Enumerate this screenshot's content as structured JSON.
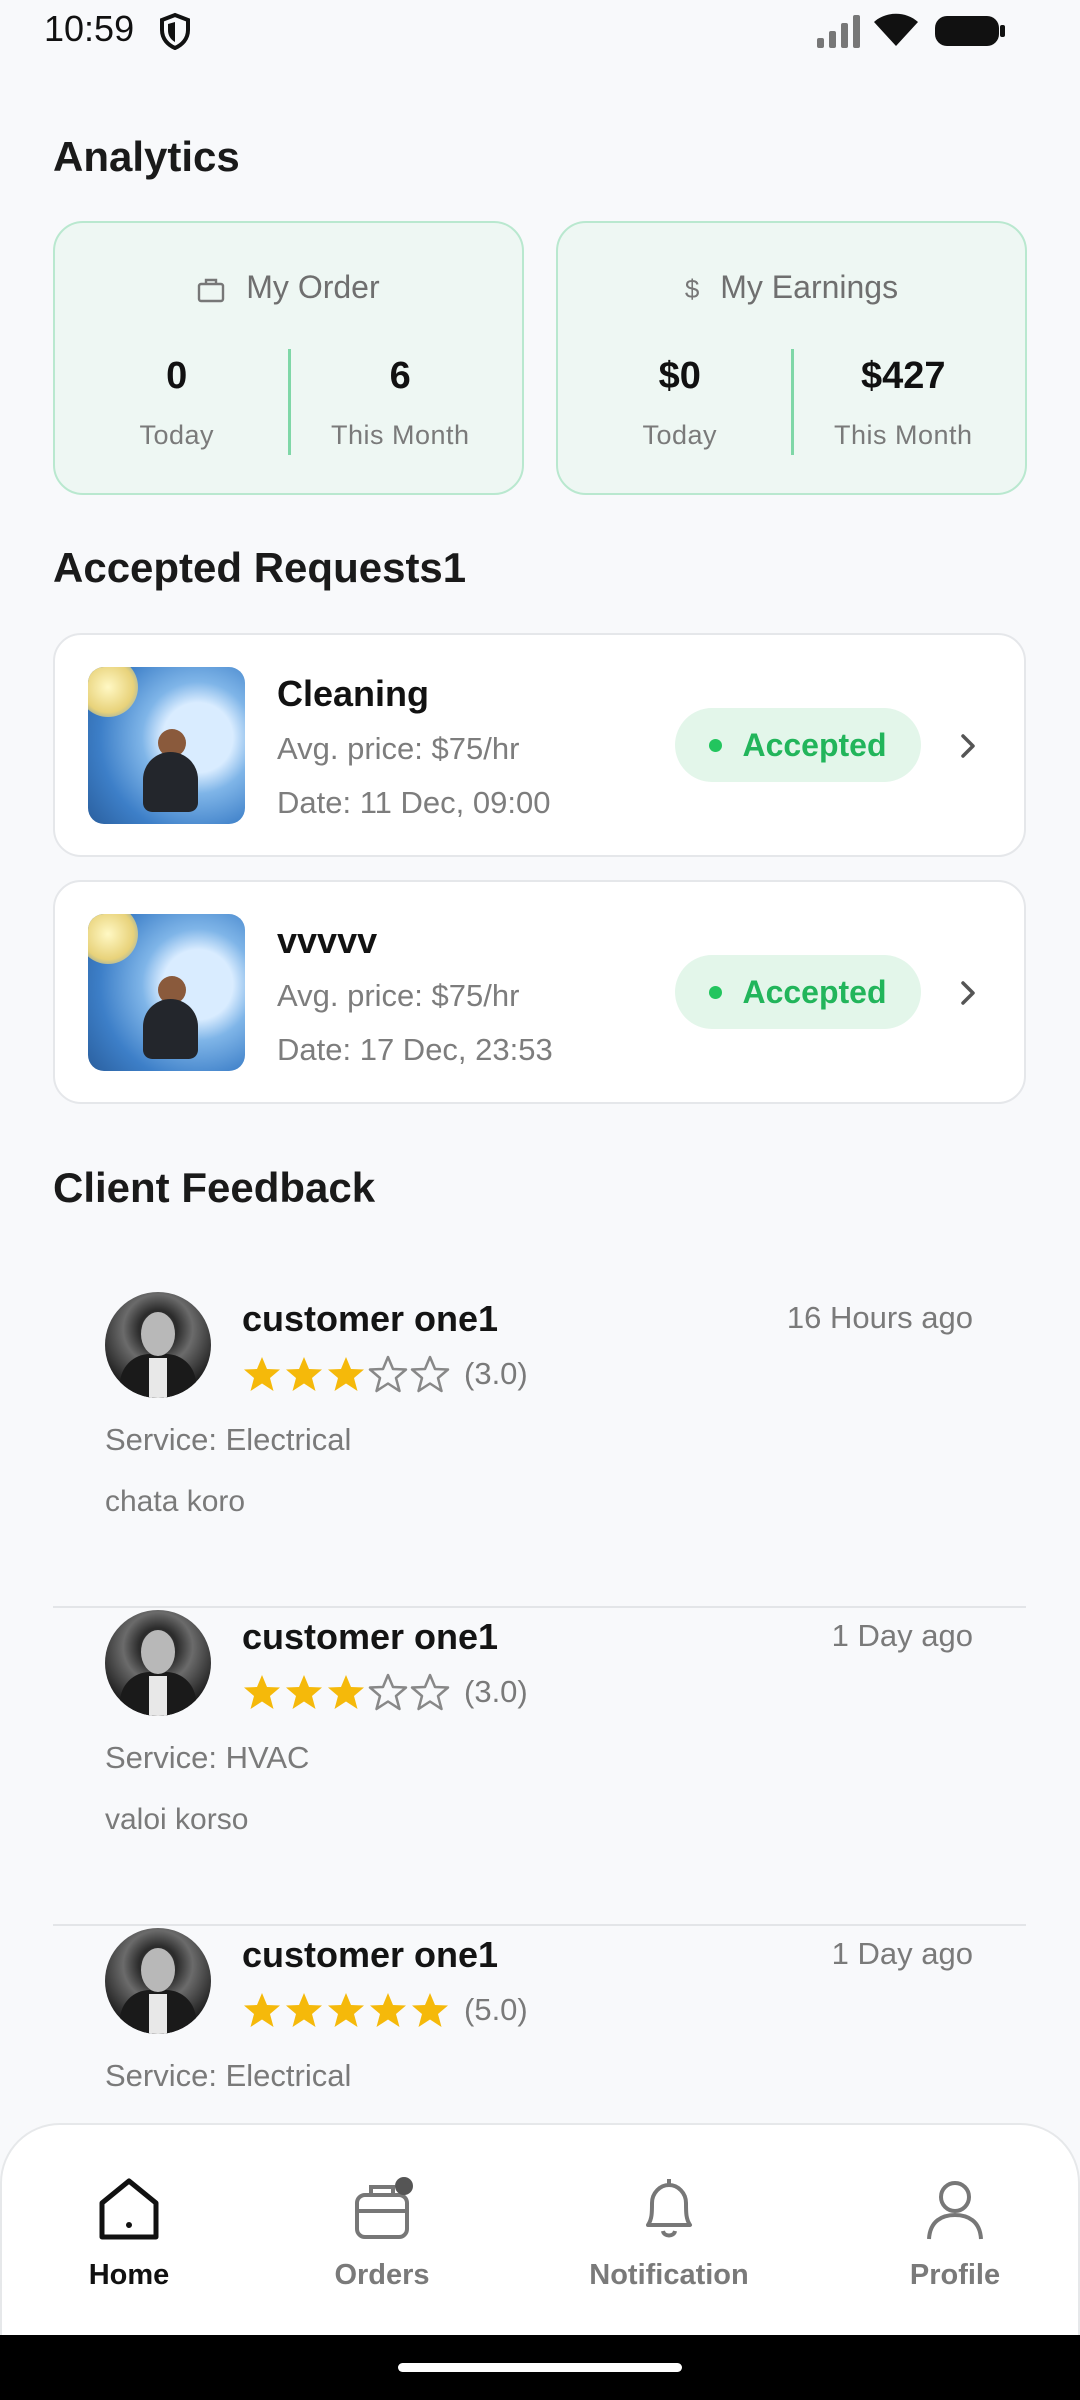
{
  "status_bar": {
    "time": "10:59"
  },
  "analytics": {
    "title": "Analytics",
    "orders_card": {
      "title": "My Order",
      "icon": "briefcase-icon",
      "today_value": "0",
      "today_label": "Today",
      "month_value": "6",
      "month_label": "This Month"
    },
    "earnings_card": {
      "title": "My Earnings",
      "icon": "dollar-icon",
      "today_value": "$0",
      "today_label": "Today",
      "month_value": "$427",
      "month_label": "This Month"
    }
  },
  "requests": {
    "title": "Accepted Requests1",
    "items": [
      {
        "title": "Cleaning",
        "price": "Avg. price: $75/hr",
        "date": "Date: 11 Dec, 09:00",
        "status": "Accepted"
      },
      {
        "title": "vvvvv",
        "price": "Avg. price: $75/hr",
        "date": "Date: 17 Dec, 23:53",
        "status": "Accepted"
      }
    ]
  },
  "feedback": {
    "title": "Client Feedback",
    "items": [
      {
        "name": "customer one1",
        "time": "16 Hours ago",
        "rating": 3,
        "score": "(3.0)",
        "service": "Service: Electrical",
        "comment": "chata koro"
      },
      {
        "name": "customer one1",
        "time": "1 Day ago",
        "rating": 3,
        "score": "(3.0)",
        "service": "Service: HVAC",
        "comment": "valoi korso"
      },
      {
        "name": "customer one1",
        "time": "1 Day ago",
        "rating": 5,
        "score": "(5.0)",
        "service": "Service: Electrical",
        "comment": ""
      }
    ]
  },
  "nav": {
    "items": [
      {
        "label": "Home",
        "icon": "home-icon",
        "active": true
      },
      {
        "label": "Orders",
        "icon": "orders-icon",
        "active": false
      },
      {
        "label": "Notification",
        "icon": "bell-icon",
        "active": false
      },
      {
        "label": "Profile",
        "icon": "user-icon",
        "active": false
      }
    ]
  },
  "colors": {
    "accent_green": "#22b55b",
    "star_yellow": "#f5b90a",
    "card_bg": "#eef7f3"
  }
}
